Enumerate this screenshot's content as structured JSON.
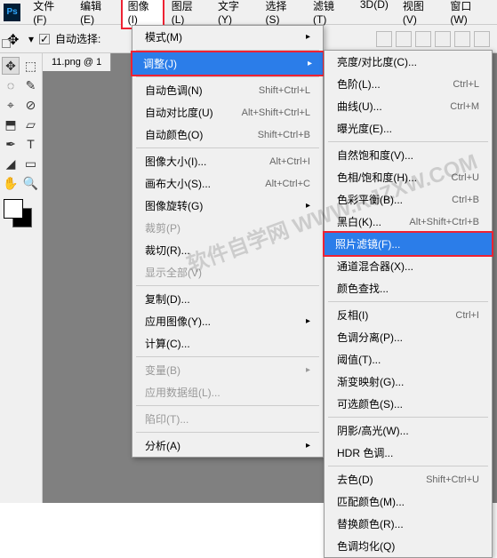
{
  "menubar": [
    "文件(F)",
    "编辑(E)",
    "图像(I)",
    "图层(L)",
    "文字(Y)",
    "选择(S)",
    "滤镜(T)",
    "3D(D)",
    "视图(V)",
    "窗口(W)"
  ],
  "optbar": {
    "auto_select": "自动选择:"
  },
  "tab": "11.png @ 1",
  "dd1": [
    {
      "t": "sub",
      "l": "模式(M)"
    },
    {
      "t": "sep"
    },
    {
      "t": "sub hl hl-red",
      "l": "调整(J)"
    },
    {
      "t": "sep"
    },
    {
      "t": "item",
      "l": "自动色调(N)",
      "s": "Shift+Ctrl+L"
    },
    {
      "t": "item",
      "l": "自动对比度(U)",
      "s": "Alt+Shift+Ctrl+L"
    },
    {
      "t": "item",
      "l": "自动颜色(O)",
      "s": "Shift+Ctrl+B"
    },
    {
      "t": "sep"
    },
    {
      "t": "item",
      "l": "图像大小(I)...",
      "s": "Alt+Ctrl+I"
    },
    {
      "t": "item",
      "l": "画布大小(S)...",
      "s": "Alt+Ctrl+C"
    },
    {
      "t": "sub",
      "l": "图像旋转(G)"
    },
    {
      "t": "item dis",
      "l": "裁剪(P)"
    },
    {
      "t": "item",
      "l": "裁切(R)..."
    },
    {
      "t": "item dis",
      "l": "显示全部(V)"
    },
    {
      "t": "sep"
    },
    {
      "t": "item",
      "l": "复制(D)..."
    },
    {
      "t": "sub",
      "l": "应用图像(Y)..."
    },
    {
      "t": "item",
      "l": "计算(C)..."
    },
    {
      "t": "sep"
    },
    {
      "t": "sub dis",
      "l": "变量(B)"
    },
    {
      "t": "item dis",
      "l": "应用数据组(L)..."
    },
    {
      "t": "sep"
    },
    {
      "t": "item dis",
      "l": "陷印(T)..."
    },
    {
      "t": "sep"
    },
    {
      "t": "sub",
      "l": "分析(A)"
    }
  ],
  "dd2": [
    {
      "t": "item",
      "l": "亮度/对比度(C)..."
    },
    {
      "t": "item",
      "l": "色阶(L)...",
      "s": "Ctrl+L"
    },
    {
      "t": "item",
      "l": "曲线(U)...",
      "s": "Ctrl+M"
    },
    {
      "t": "item",
      "l": "曝光度(E)..."
    },
    {
      "t": "sep"
    },
    {
      "t": "item",
      "l": "自然饱和度(V)..."
    },
    {
      "t": "item",
      "l": "色相/饱和度(H)...",
      "s": "Ctrl+U"
    },
    {
      "t": "item",
      "l": "色彩平衡(B)...",
      "s": "Ctrl+B"
    },
    {
      "t": "item",
      "l": "黑白(K)...",
      "s": "Alt+Shift+Ctrl+B"
    },
    {
      "t": "item hl hl-red",
      "l": "照片滤镜(F)..."
    },
    {
      "t": "item",
      "l": "通道混合器(X)..."
    },
    {
      "t": "item",
      "l": "颜色查找..."
    },
    {
      "t": "sep"
    },
    {
      "t": "item",
      "l": "反相(I)",
      "s": "Ctrl+I"
    },
    {
      "t": "item",
      "l": "色调分离(P)..."
    },
    {
      "t": "item",
      "l": "阈值(T)..."
    },
    {
      "t": "item",
      "l": "渐变映射(G)..."
    },
    {
      "t": "item",
      "l": "可选颜色(S)..."
    },
    {
      "t": "sep"
    },
    {
      "t": "item",
      "l": "阴影/高光(W)..."
    },
    {
      "t": "item",
      "l": "HDR 色调..."
    },
    {
      "t": "sep"
    },
    {
      "t": "item",
      "l": "去色(D)",
      "s": "Shift+Ctrl+U"
    },
    {
      "t": "item",
      "l": "匹配颜色(M)..."
    },
    {
      "t": "item",
      "l": "替换颜色(R)..."
    },
    {
      "t": "item",
      "l": "色调均化(Q)"
    }
  ],
  "tools": [
    "✥",
    "⬚",
    "◌",
    "✎",
    "⌖",
    "⊘",
    "⬒",
    "▱",
    "✒",
    "T",
    "◢",
    "▭",
    "✋",
    "🔍"
  ],
  "watermark": "软件自学网\nWWW.RJZXW.COM"
}
